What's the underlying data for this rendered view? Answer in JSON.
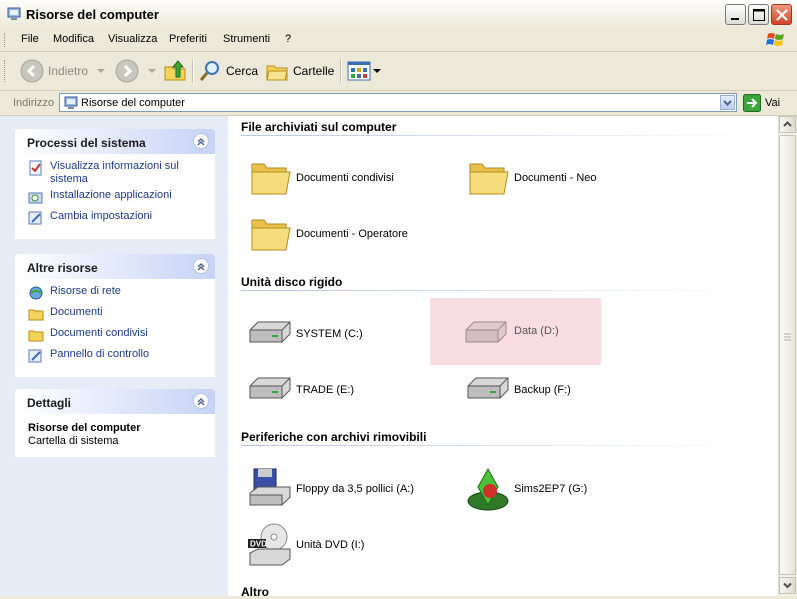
{
  "window": {
    "title": "Risorse del computer"
  },
  "menu": [
    "File",
    "Modifica",
    "Visualizza",
    "Preferiti",
    "Strumenti",
    "?"
  ],
  "toolbar": {
    "back": "Indietro",
    "search": "Cerca",
    "folders": "Cartelle"
  },
  "address": {
    "label": "Indirizzo",
    "value": "Risorse del computer",
    "go": "Vai"
  },
  "tasks": {
    "title": "Processi del sistema",
    "items": [
      "Visualizza informazioni sul sistema",
      "Installazione applicazioni",
      "Cambia impostazioni"
    ]
  },
  "other": {
    "title": "Altre risorse",
    "items": [
      "Risorse di rete",
      "Documenti",
      "Documenti condivisi",
      "Pannello di controllo"
    ]
  },
  "details": {
    "title": "Dettagli",
    "name": "Risorse del computer",
    "desc": "Cartella di sistema"
  },
  "sections": {
    "files": {
      "title": "File archiviati sul computer",
      "items": [
        "Documenti condivisi",
        "Documenti - Neo",
        "Documenti - Operatore"
      ]
    },
    "drives": {
      "title": "Unità disco rigido",
      "items": [
        "SYSTEM (C:)",
        "Data (D:)",
        "TRADE (E:)",
        "Backup (F:)"
      ]
    },
    "removable": {
      "title": "Periferiche con archivi rimovibili",
      "items": [
        "Floppy da 3,5 pollici (A:)",
        "Sims2EP7 (G:)",
        "Unità DVD (I:)"
      ]
    },
    "other": {
      "title": "Altro"
    }
  }
}
